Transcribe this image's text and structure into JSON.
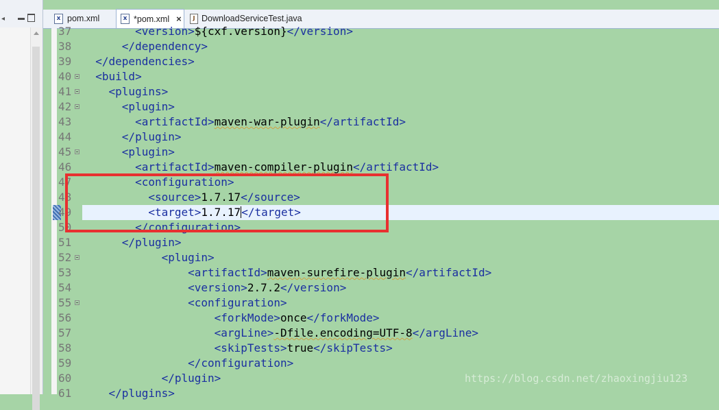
{
  "tabs": [
    {
      "label": "pom.xml",
      "icon": "xml-file-icon",
      "active": false
    },
    {
      "label": "*pom.xml",
      "icon": "xml-file-icon",
      "active": true,
      "close": "×"
    },
    {
      "label": "DownloadServiceTest.java",
      "icon": "java-file-icon",
      "active": false
    }
  ],
  "editor": {
    "lines": [
      {
        "num": "37",
        "fold": false,
        "parts": [
          [
            "tag",
            "        <version>"
          ],
          [
            "txt",
            "${cxf.version}"
          ],
          [
            "tag",
            "</version>"
          ]
        ]
      },
      {
        "num": "38",
        "fold": false,
        "parts": [
          [
            "tag",
            "      </dependency>"
          ]
        ]
      },
      {
        "num": "39",
        "fold": false,
        "parts": [
          [
            "tag",
            "  </dependencies>"
          ]
        ]
      },
      {
        "num": "40",
        "fold": true,
        "parts": [
          [
            "tag",
            "  <build>"
          ]
        ]
      },
      {
        "num": "41",
        "fold": true,
        "parts": [
          [
            "tag",
            "    <plugins>"
          ]
        ]
      },
      {
        "num": "42",
        "fold": true,
        "parts": [
          [
            "tag",
            "      <plugin>"
          ]
        ]
      },
      {
        "num": "43",
        "fold": false,
        "parts": [
          [
            "tag",
            "        <artifactId>"
          ],
          [
            "txt",
            "maven-war-plugin"
          ],
          [
            "tag",
            "</artifactId>"
          ]
        ]
      },
      {
        "num": "44",
        "fold": false,
        "parts": [
          [
            "tag",
            "      </plugin>"
          ]
        ]
      },
      {
        "num": "45",
        "fold": true,
        "parts": [
          [
            "tag",
            "      <plugin>"
          ]
        ]
      },
      {
        "num": "46",
        "fold": false,
        "parts": [
          [
            "tag",
            "        <artifactId>"
          ],
          [
            "txt",
            "maven-compiler-plugin"
          ],
          [
            "tag",
            "</artifactId>"
          ]
        ]
      },
      {
        "num": "47",
        "fold": false,
        "parts": [
          [
            "tag",
            "        <configuration>"
          ]
        ]
      },
      {
        "num": "48",
        "fold": false,
        "parts": [
          [
            "tag",
            "          <source>"
          ],
          [
            "txt",
            "1.7.17"
          ],
          [
            "tag",
            "</source>"
          ]
        ]
      },
      {
        "num": "49",
        "fold": false,
        "current": true,
        "parts": [
          [
            "tag",
            "          <target>"
          ],
          [
            "txt",
            "1.7.17"
          ],
          [
            "caret",
            ""
          ],
          [
            "tag",
            "</target>"
          ]
        ]
      },
      {
        "num": "50",
        "fold": false,
        "parts": [
          [
            "tag",
            "        </configuration>"
          ]
        ]
      },
      {
        "num": "51",
        "fold": false,
        "parts": [
          [
            "tag",
            "      </plugin>"
          ]
        ]
      },
      {
        "num": "52",
        "fold": true,
        "parts": [
          [
            "tag",
            "            <plugin>"
          ]
        ]
      },
      {
        "num": "53",
        "fold": false,
        "parts": [
          [
            "tag",
            "                <artifactId>"
          ],
          [
            "txt",
            "maven-surefire-plugin"
          ],
          [
            "tag",
            "</artifactId>"
          ]
        ]
      },
      {
        "num": "54",
        "fold": false,
        "parts": [
          [
            "tag",
            "                <version>"
          ],
          [
            "txt",
            "2.7.2"
          ],
          [
            "tag",
            "</version>"
          ]
        ]
      },
      {
        "num": "55",
        "fold": true,
        "parts": [
          [
            "tag",
            "                <configuration>"
          ]
        ]
      },
      {
        "num": "56",
        "fold": false,
        "parts": [
          [
            "tag",
            "                    <forkMode>"
          ],
          [
            "txt",
            "once"
          ],
          [
            "tag",
            "</forkMode>"
          ]
        ]
      },
      {
        "num": "57",
        "fold": false,
        "parts": [
          [
            "tag",
            "                    <argLine>"
          ],
          [
            "txt",
            "-Dfile.encoding=UTF-8"
          ],
          [
            "tag",
            "</argLine>"
          ]
        ]
      },
      {
        "num": "58",
        "fold": false,
        "parts": [
          [
            "tag",
            "                    <skipTests>"
          ],
          [
            "txt",
            "true"
          ],
          [
            "tag",
            "</skipTests>"
          ]
        ]
      },
      {
        "num": "59",
        "fold": false,
        "parts": [
          [
            "tag",
            "                </configuration>"
          ]
        ]
      },
      {
        "num": "60",
        "fold": false,
        "parts": [
          [
            "tag",
            "            </plugin>"
          ]
        ]
      },
      {
        "num": "61",
        "fold": false,
        "parts": [
          [
            "tag",
            "    </plugins>"
          ]
        ]
      }
    ]
  },
  "watermark": "https://blog.csdn.net/zhaoxingjiu123",
  "colors": {
    "editor_bg": "#a6d4a6",
    "tag": "#1a2fa0",
    "highlight_box": "#e83030",
    "current_line": "#e8f2fe"
  }
}
